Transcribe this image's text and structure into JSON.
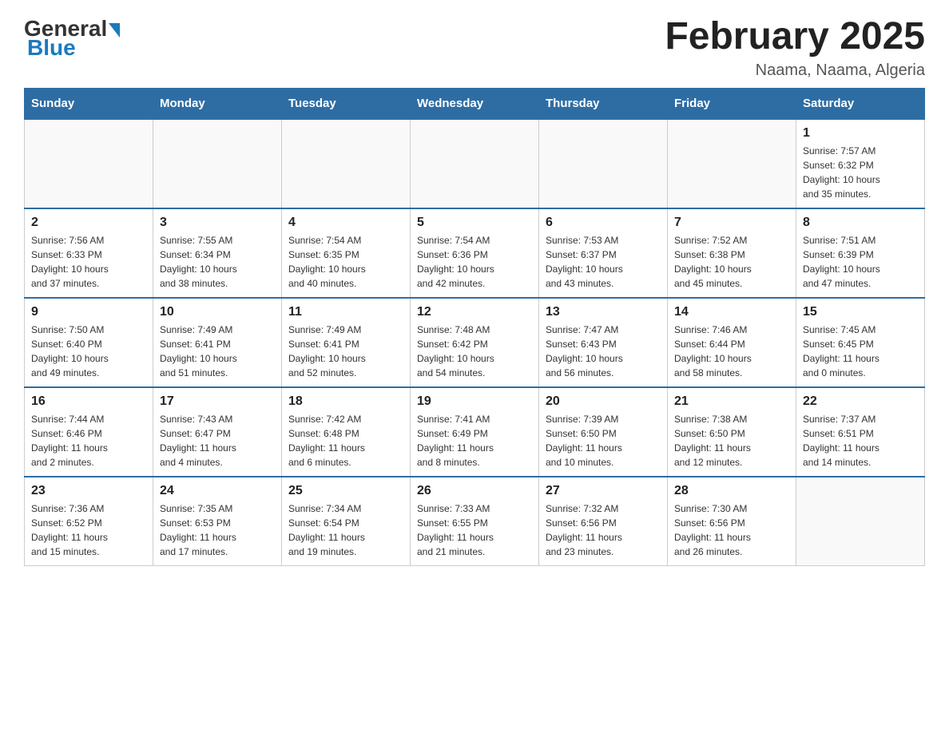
{
  "logo": {
    "general": "General",
    "blue": "Blue"
  },
  "title": "February 2025",
  "subtitle": "Naama, Naama, Algeria",
  "days_of_week": [
    "Sunday",
    "Monday",
    "Tuesday",
    "Wednesday",
    "Thursday",
    "Friday",
    "Saturday"
  ],
  "weeks": [
    [
      {
        "day": "",
        "info": ""
      },
      {
        "day": "",
        "info": ""
      },
      {
        "day": "",
        "info": ""
      },
      {
        "day": "",
        "info": ""
      },
      {
        "day": "",
        "info": ""
      },
      {
        "day": "",
        "info": ""
      },
      {
        "day": "1",
        "info": "Sunrise: 7:57 AM\nSunset: 6:32 PM\nDaylight: 10 hours\nand 35 minutes."
      }
    ],
    [
      {
        "day": "2",
        "info": "Sunrise: 7:56 AM\nSunset: 6:33 PM\nDaylight: 10 hours\nand 37 minutes."
      },
      {
        "day": "3",
        "info": "Sunrise: 7:55 AM\nSunset: 6:34 PM\nDaylight: 10 hours\nand 38 minutes."
      },
      {
        "day": "4",
        "info": "Sunrise: 7:54 AM\nSunset: 6:35 PM\nDaylight: 10 hours\nand 40 minutes."
      },
      {
        "day": "5",
        "info": "Sunrise: 7:54 AM\nSunset: 6:36 PM\nDaylight: 10 hours\nand 42 minutes."
      },
      {
        "day": "6",
        "info": "Sunrise: 7:53 AM\nSunset: 6:37 PM\nDaylight: 10 hours\nand 43 minutes."
      },
      {
        "day": "7",
        "info": "Sunrise: 7:52 AM\nSunset: 6:38 PM\nDaylight: 10 hours\nand 45 minutes."
      },
      {
        "day": "8",
        "info": "Sunrise: 7:51 AM\nSunset: 6:39 PM\nDaylight: 10 hours\nand 47 minutes."
      }
    ],
    [
      {
        "day": "9",
        "info": "Sunrise: 7:50 AM\nSunset: 6:40 PM\nDaylight: 10 hours\nand 49 minutes."
      },
      {
        "day": "10",
        "info": "Sunrise: 7:49 AM\nSunset: 6:41 PM\nDaylight: 10 hours\nand 51 minutes."
      },
      {
        "day": "11",
        "info": "Sunrise: 7:49 AM\nSunset: 6:41 PM\nDaylight: 10 hours\nand 52 minutes."
      },
      {
        "day": "12",
        "info": "Sunrise: 7:48 AM\nSunset: 6:42 PM\nDaylight: 10 hours\nand 54 minutes."
      },
      {
        "day": "13",
        "info": "Sunrise: 7:47 AM\nSunset: 6:43 PM\nDaylight: 10 hours\nand 56 minutes."
      },
      {
        "day": "14",
        "info": "Sunrise: 7:46 AM\nSunset: 6:44 PM\nDaylight: 10 hours\nand 58 minutes."
      },
      {
        "day": "15",
        "info": "Sunrise: 7:45 AM\nSunset: 6:45 PM\nDaylight: 11 hours\nand 0 minutes."
      }
    ],
    [
      {
        "day": "16",
        "info": "Sunrise: 7:44 AM\nSunset: 6:46 PM\nDaylight: 11 hours\nand 2 minutes."
      },
      {
        "day": "17",
        "info": "Sunrise: 7:43 AM\nSunset: 6:47 PM\nDaylight: 11 hours\nand 4 minutes."
      },
      {
        "day": "18",
        "info": "Sunrise: 7:42 AM\nSunset: 6:48 PM\nDaylight: 11 hours\nand 6 minutes."
      },
      {
        "day": "19",
        "info": "Sunrise: 7:41 AM\nSunset: 6:49 PM\nDaylight: 11 hours\nand 8 minutes."
      },
      {
        "day": "20",
        "info": "Sunrise: 7:39 AM\nSunset: 6:50 PM\nDaylight: 11 hours\nand 10 minutes."
      },
      {
        "day": "21",
        "info": "Sunrise: 7:38 AM\nSunset: 6:50 PM\nDaylight: 11 hours\nand 12 minutes."
      },
      {
        "day": "22",
        "info": "Sunrise: 7:37 AM\nSunset: 6:51 PM\nDaylight: 11 hours\nand 14 minutes."
      }
    ],
    [
      {
        "day": "23",
        "info": "Sunrise: 7:36 AM\nSunset: 6:52 PM\nDaylight: 11 hours\nand 15 minutes."
      },
      {
        "day": "24",
        "info": "Sunrise: 7:35 AM\nSunset: 6:53 PM\nDaylight: 11 hours\nand 17 minutes."
      },
      {
        "day": "25",
        "info": "Sunrise: 7:34 AM\nSunset: 6:54 PM\nDaylight: 11 hours\nand 19 minutes."
      },
      {
        "day": "26",
        "info": "Sunrise: 7:33 AM\nSunset: 6:55 PM\nDaylight: 11 hours\nand 21 minutes."
      },
      {
        "day": "27",
        "info": "Sunrise: 7:32 AM\nSunset: 6:56 PM\nDaylight: 11 hours\nand 23 minutes."
      },
      {
        "day": "28",
        "info": "Sunrise: 7:30 AM\nSunset: 6:56 PM\nDaylight: 11 hours\nand 26 minutes."
      },
      {
        "day": "",
        "info": ""
      }
    ]
  ]
}
